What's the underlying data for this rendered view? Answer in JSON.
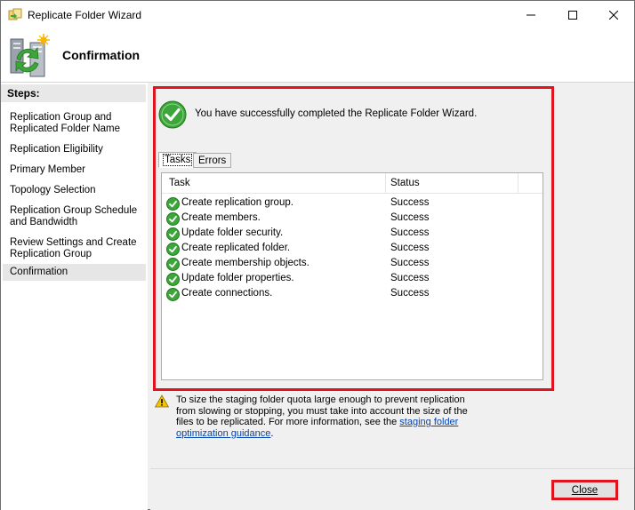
{
  "window": {
    "title": "Replicate Folder Wizard",
    "controls": [
      "minimize",
      "maximize",
      "close"
    ]
  },
  "header": {
    "title": "Confirmation"
  },
  "nav": {
    "heading": "Steps:",
    "items": [
      {
        "label": "Replication Group and Replicated Folder Name"
      },
      {
        "label": "Replication Eligibility"
      },
      {
        "label": "Primary Member"
      },
      {
        "label": "Topology Selection"
      },
      {
        "label": "Replication Group Schedule and Bandwidth"
      },
      {
        "label": "Review Settings and Create Replication Group"
      },
      {
        "label": "Confirmation",
        "current": true
      }
    ]
  },
  "main": {
    "success_message": "You have successfully completed the Replicate Folder Wizard.",
    "tabs": [
      {
        "label": "Tasks",
        "active": true
      },
      {
        "label": "Errors",
        "active": false
      }
    ],
    "table": {
      "columns": [
        "Task",
        "Status"
      ],
      "rows": [
        {
          "task": "Create replication group.",
          "status": "Success"
        },
        {
          "task": "Create members.",
          "status": "Success"
        },
        {
          "task": "Update folder security.",
          "status": "Success"
        },
        {
          "task": "Create replicated folder.",
          "status": "Success"
        },
        {
          "task": "Create membership objects.",
          "status": "Success"
        },
        {
          "task": "Update folder properties.",
          "status": "Success"
        },
        {
          "task": "Create connections.",
          "status": "Success"
        }
      ]
    },
    "warning": {
      "text": "To size the staging folder quota large enough to prevent replication from slowing or stopping, you must take into account the size of the files to be replicated. For more information, see the ",
      "link": "staging folder optimization guidance",
      "suffix": "."
    }
  },
  "footer": {
    "close_label": "Close"
  },
  "colors": {
    "highlight": "#e0141e",
    "success_green": "#3da63a",
    "link": "#0645ad",
    "warning_yellow": "#f5c400"
  }
}
